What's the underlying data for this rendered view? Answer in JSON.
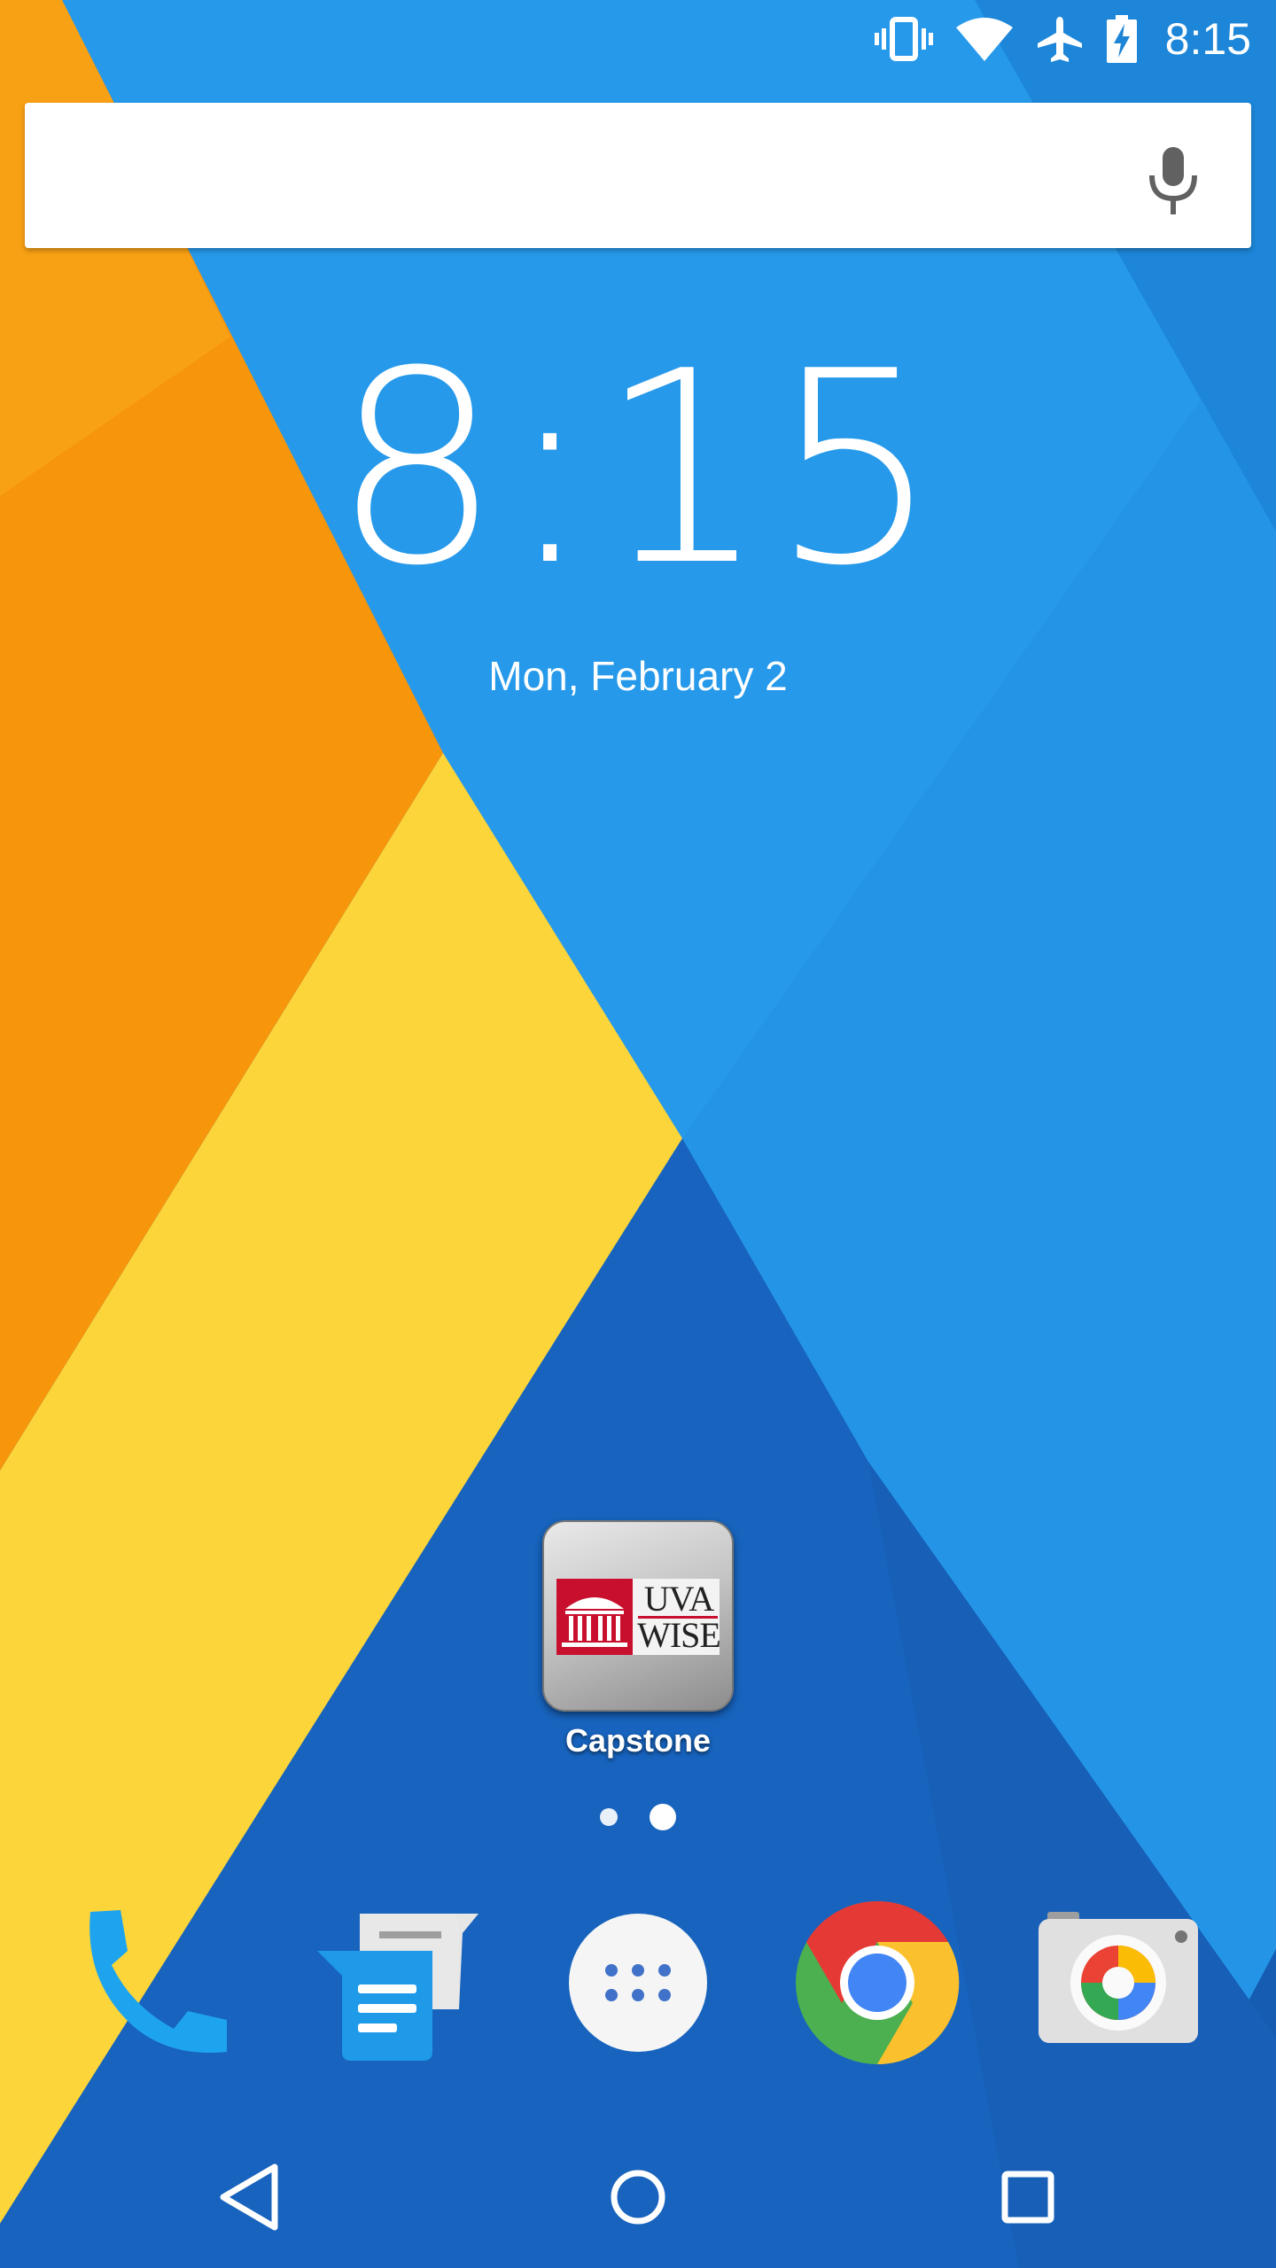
{
  "status_bar": {
    "icons": [
      "vibrate-icon",
      "wifi-icon",
      "airplane-mode-icon",
      "battery-charging-icon"
    ],
    "time": "8:15"
  },
  "search": {
    "placeholder": "",
    "icon": "mic-icon"
  },
  "clock_widget": {
    "time": "8:15",
    "date": "Mon, February 2"
  },
  "home_apps": [
    {
      "label": "Capstone",
      "icon": "uva-wise-icon",
      "logo_text": [
        "UVA",
        "WISE"
      ]
    }
  ],
  "page_indicator": {
    "pages": 2,
    "current": 2
  },
  "dock": [
    {
      "name": "phone",
      "icon": "phone-icon"
    },
    {
      "name": "messenger",
      "icon": "messenger-icon"
    },
    {
      "name": "app-drawer",
      "icon": "app-drawer-icon"
    },
    {
      "name": "chrome",
      "icon": "chrome-icon"
    },
    {
      "name": "camera",
      "icon": "camera-icon"
    }
  ],
  "nav_bar": [
    "back-icon",
    "home-icon",
    "recents-icon"
  ],
  "colors": {
    "wallpaper_blue": "#259ae9",
    "wallpaper_dark_blue": "#1868c0",
    "wallpaper_orange": "#f8980c",
    "wallpaper_yellow": "#fcd63c",
    "uva_red": "#c8102e"
  }
}
